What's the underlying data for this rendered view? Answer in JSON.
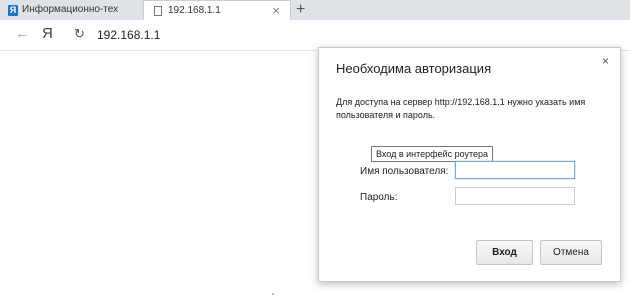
{
  "tabs": [
    {
      "title": "Информационно-тех"
    },
    {
      "title": "192.168.1.1",
      "close": "×"
    }
  ],
  "newtab": "+",
  "toolbar": {
    "back": "←",
    "browser_button": "Я",
    "reload": "↻",
    "url": "192.168.1.1"
  },
  "dialog": {
    "close": "×",
    "title": "Необходима авторизация",
    "description": "Для доступа на сервер http://192.168.1.1 нужно указать имя пользователя и пароль.",
    "tooltip": "Вход в интерфейс роутера",
    "username_label": "Имя пользователя:",
    "username_value": "",
    "password_label": "Пароль:",
    "password_value": "",
    "login_button": "Вход",
    "cancel_button": "Отмена"
  },
  "colors": {
    "accent": "#1e73c8",
    "progress": "#e53935",
    "focus": "#7aa7e0"
  },
  "icons": {
    "tab1": "yandex-icon",
    "tab2": "page-icon"
  }
}
